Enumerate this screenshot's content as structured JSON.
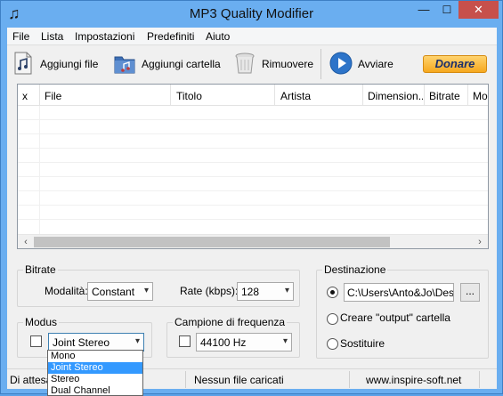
{
  "window": {
    "title": "MP3 Quality Modifier",
    "buttons": {
      "minimize": "—",
      "maximize": "☐",
      "close": "✕"
    }
  },
  "menu": [
    "File",
    "Lista",
    "Impostazioni",
    "Predefiniti",
    "Aiuto"
  ],
  "toolbar": {
    "add_file": "Aggiungi file",
    "add_folder": "Aggiungi cartella",
    "remove": "Rimuovere",
    "start": "Avviare",
    "donate": "Donare"
  },
  "file_list": {
    "columns": [
      "x",
      "File",
      "Titolo",
      "Artista",
      "Dimension...",
      "Bitrate",
      "Mo"
    ],
    "rows": []
  },
  "bitrate": {
    "title": "Bitrate",
    "mode_label": "Modalità:",
    "mode_value": "Constant",
    "rate_label": "Rate (kbps):",
    "rate_value": "128"
  },
  "modus": {
    "title": "Modus",
    "value": "Joint Stereo",
    "options": [
      "Mono",
      "Joint Stereo",
      "Stereo",
      "Dual Channel"
    ],
    "selected_option": "Joint Stereo"
  },
  "frequency": {
    "title": "Campione di frequenza",
    "value": "44100 Hz"
  },
  "destination": {
    "title": "Destinazione",
    "path": "C:\\Users\\Anto&Jo\\Deskt",
    "browse": "...",
    "create_output": "Creare \"output\" cartella",
    "replace": "Sostituire"
  },
  "status": {
    "state": "Di attesa",
    "files": "Nessun file caricati",
    "website": "www.inspire-soft.net"
  }
}
